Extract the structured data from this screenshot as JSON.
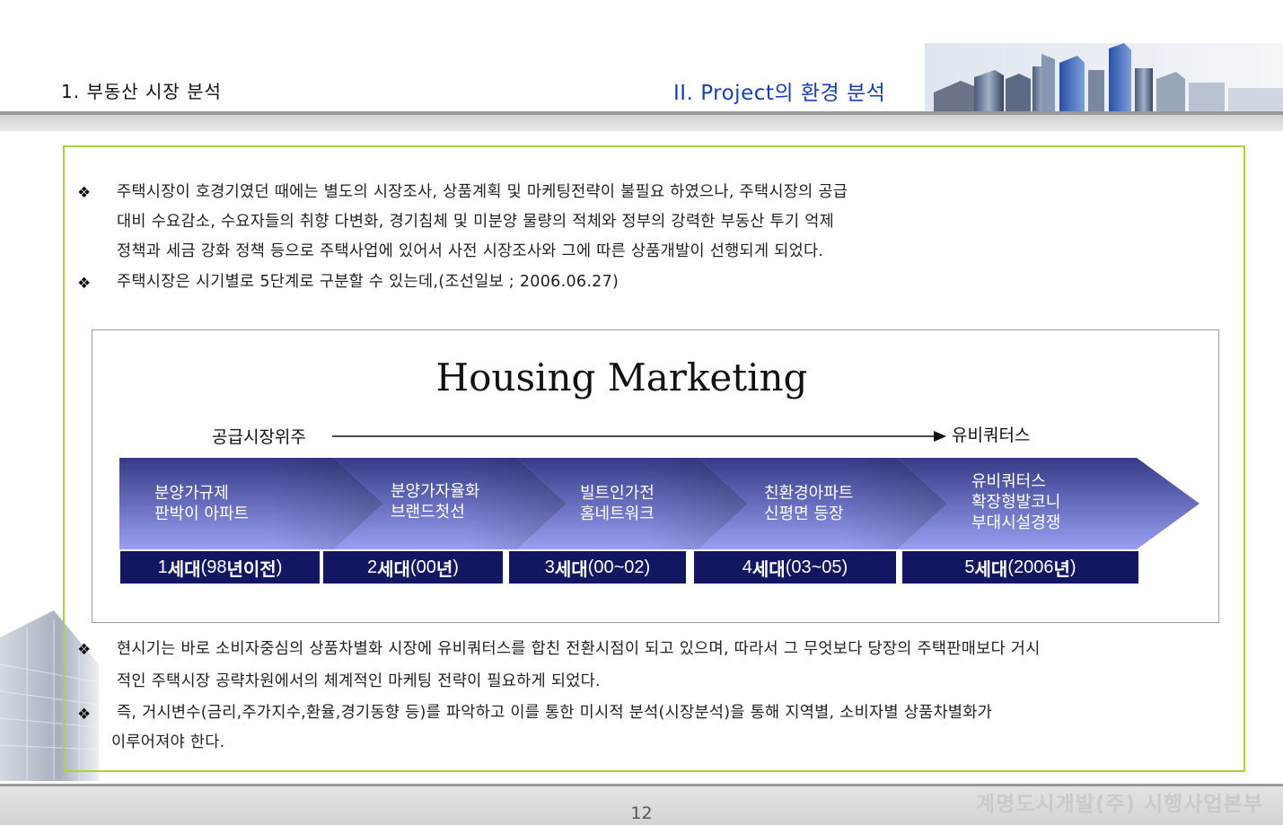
{
  "header": {
    "section_title": "1. 부동산 시장 분석",
    "chapter_title": "II. Project의 환경 분석"
  },
  "bullet_symbol": "❖",
  "paragraphs": {
    "p1_line1": "주택시장이 호경기였던 때에는 별도의 시장조사, 상품계획 및 마케팅전략이 불필요 하였으나, 주택시장의 공급",
    "p1_line2": "대비 수요감소, 수요자들의 취향 다변화, 경기침체 및 미분양 물량의 적체와 정부의 강력한 부동산 투기 억제",
    "p1_line3": "정책과 세금 강화 정책 등으로 주택사업에 있어서 사전 시장조사와  그에 따른 상품개발이 선행되게 되었다.",
    "p2_line1": "주택시장은 시기별로 5단계로 구분할 수 있는데,(조선일보 ; 2006.06.27)",
    "p3_line1": "현시기는 바로 소비자중심의 상품차별화 시장에 유비쿼터스를 합친 전환시점이 되고 있으며, 따라서 그 무엇보다 당장의 주택판매보다 거시",
    "p3_line2": "적인 주택시장 공략차원에서의 체계적인 마케팅 전략이 필요하게 되었다.",
    "p4_line1": "즉, 거시변수(금리,주가지수,환율,경기동향 등)를 파악하고 이를 통한 미시적 분석(시장분석)을 통해 지역별, 소비자별 상품차별화가",
    "p4_line2": "이루어져야 한다."
  },
  "diagram": {
    "title": "Housing Marketing",
    "axis_start": "공급시장위주",
    "axis_end": "유비쿼터스",
    "stages": [
      {
        "line1": "분양가규제",
        "line2": "판박이 아파트",
        "line3": ""
      },
      {
        "line1": "분양가자율화",
        "line2": "브랜드첫선",
        "line3": ""
      },
      {
        "line1": "빌트인가전",
        "line2": "홈네트워크",
        "line3": ""
      },
      {
        "line1": "친환경아파트",
        "line2": "신평면 등장",
        "line3": ""
      },
      {
        "line1": "유비쿼터스",
        "line2": "확장형발코니",
        "line3": "부대시설경쟁"
      }
    ],
    "generations": [
      {
        "num": "1",
        "gen": "세대",
        "open": "(98",
        "year_word": "년이전",
        "close": ")"
      },
      {
        "num": "2",
        "gen": "세대",
        "open": "(00",
        "year_word": "년",
        "close": ")"
      },
      {
        "num": "3",
        "gen": "세대",
        "open": "(00~02)",
        "year_word": "",
        "close": ""
      },
      {
        "num": "4",
        "gen": "세대",
        "open": "(03~05)",
        "year_word": "",
        "close": ""
      },
      {
        "num": "5",
        "gen": "세대",
        "open": "(2006",
        "year_word": "년",
        "close": ")"
      }
    ],
    "colors": {
      "chevron_light": "#9aa0f2",
      "chevron_dark": "#353a86",
      "generation_bg": "#131660",
      "frame_green": "#a8d43a"
    }
  },
  "footer": {
    "page_number": "12",
    "company": "계명도시개발(주) 시행사업본부"
  }
}
